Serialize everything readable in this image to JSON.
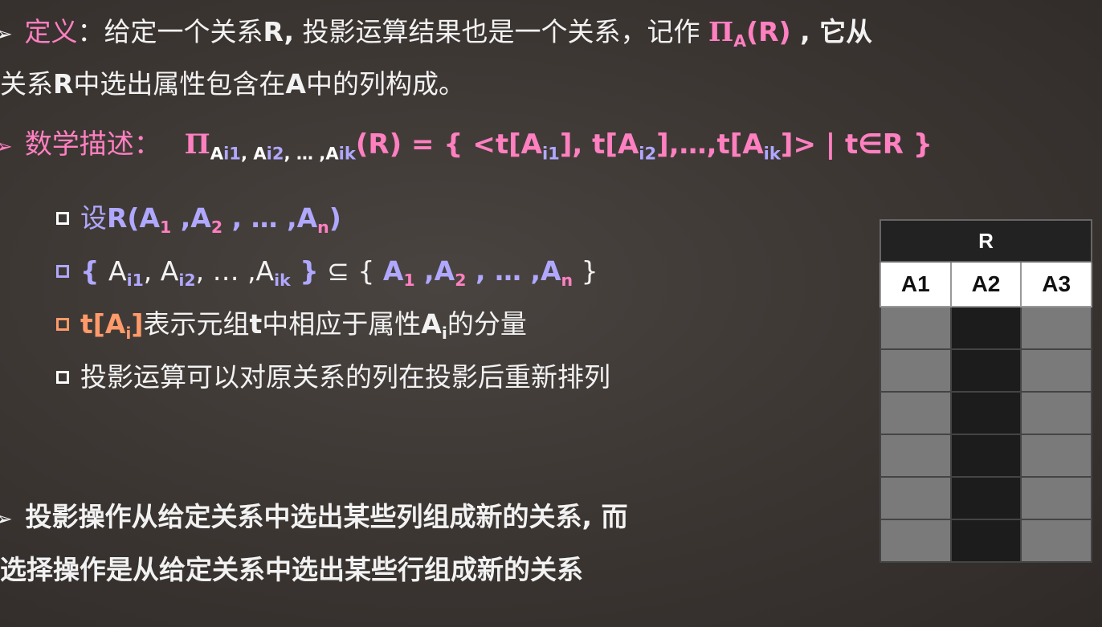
{
  "def": {
    "label": "定义",
    "text1": "：给定一个关系",
    "r": "R,",
    "text2": " 投影运算结果也是一个关系，记作 ",
    "pi": "Π",
    "sub_a": "A",
    "paren_r": "(R)",
    "text3": " , 它从",
    "line2_a": "关系",
    "line2_r": "R",
    "line2_b": "中选出属性包含在",
    "line2_A": "A",
    "line2_c": "中的列构成。"
  },
  "math": {
    "label": "数学描述：",
    "pi": "Π",
    "expr_a": "A",
    "s1": "i1",
    "mid1": ", A",
    "s2": "i2",
    "mid2": ", … ,A",
    "sk": "ik",
    "rhs1": "(R) = { <t[A",
    "rs1": "i1",
    "rhs2": "], t[A",
    "rs2": "i2",
    "rhs3": "],…,t[A",
    "rsk": "ik",
    "rhs4": "]>  |  t∈R }"
  },
  "bullets": {
    "b1_pre": "设",
    "b1_a": "R(A",
    "b1_s1": "1",
    "b1_b": " ,A",
    "b1_s2": "2",
    "b1_c": " , … ,A",
    "b1_sn": "n",
    "b1_d": ")",
    "b2_a": "{ ",
    "b2_b": "A",
    "b2_s1": "i1",
    "b2_c": ", A",
    "b2_s2": "i2",
    "b2_d": ", … ,A",
    "b2_sk": "ik",
    "b2_e": " }",
    "b2_sub": " ⊆ { ",
    "b2_f": "A",
    "b2_f1": "1",
    "b2_g": " ,A",
    "b2_g2": "2",
    "b2_h": " , … ,A",
    "b2_hn": "n",
    "b2_i": " }",
    "b3_a": "t[A",
    "b3_s": "i",
    "b3_b": "]",
    "b3_c": "表示元组",
    "b3_t": "t",
    "b3_d": "中相应于属性",
    "b3_A": "A",
    "b3_s2": "i",
    "b3_e": "的分量",
    "b4": "投影运算可以对原关系的列在投影后重新排列"
  },
  "summary": {
    "line1": "投影操作从给定关系中选出某些列组成新的关系, 而",
    "line2": "选择操作是从给定关系中选出某些行组成新的关系"
  },
  "table": {
    "title": "R",
    "columns": [
      "A1",
      "A2",
      "A3"
    ],
    "row_count": 6,
    "selected_column": "A2"
  }
}
